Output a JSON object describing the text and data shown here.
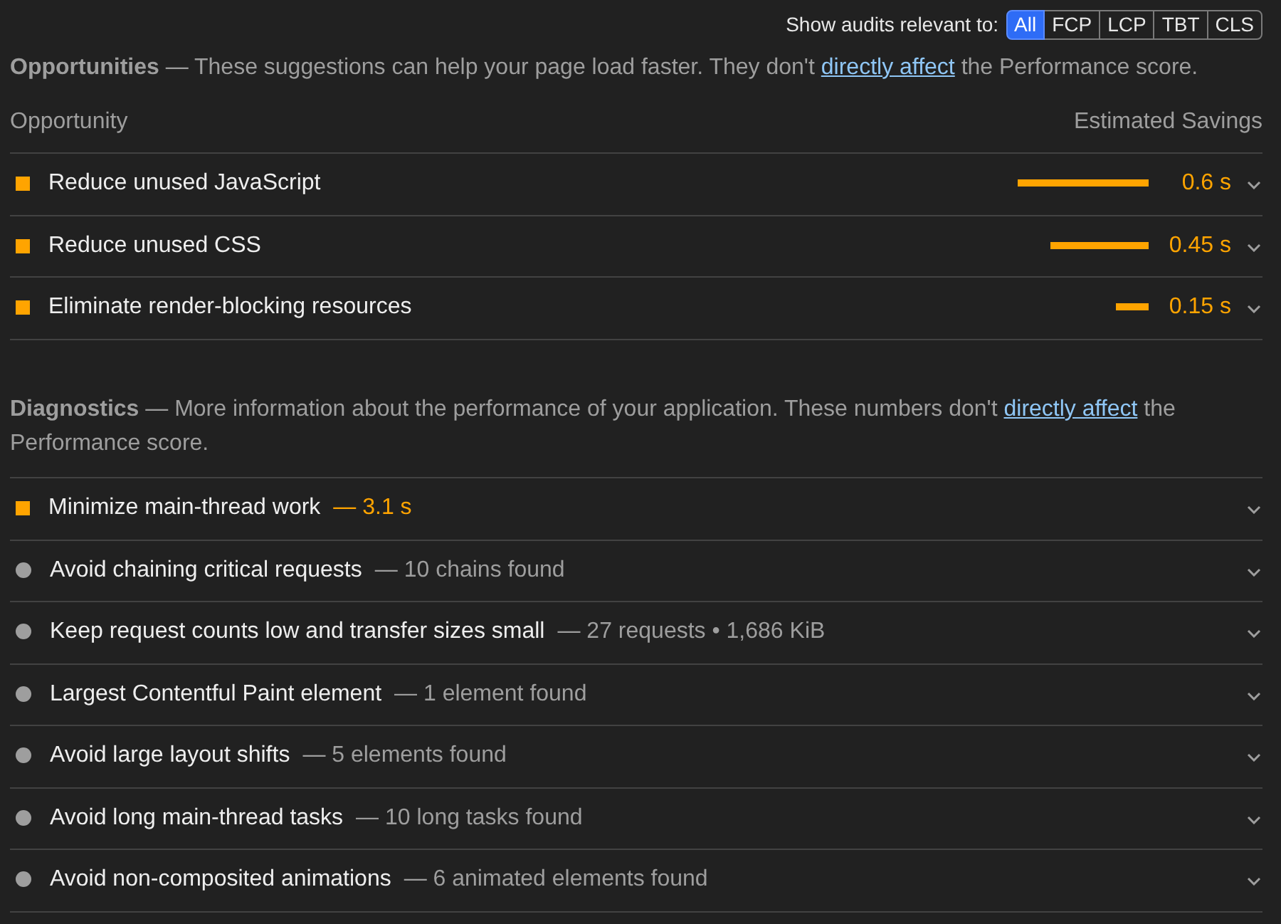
{
  "filter": {
    "label": "Show audits relevant to:",
    "options": [
      {
        "label": "All",
        "selected": true
      },
      {
        "label": "FCP",
        "selected": false
      },
      {
        "label": "LCP",
        "selected": false
      },
      {
        "label": "TBT",
        "selected": false
      },
      {
        "label": "CLS",
        "selected": false
      }
    ]
  },
  "opportunities": {
    "intro": {
      "text": "**Opportunities** — These suggestions can help your page load faster. They don't",
      "link": "directly affect",
      "text_after": "the Performance score."
    },
    "columns": [
      "Opportunity",
      "Estimated Savings"
    ],
    "rows": [
      {
        "kind": "average",
        "title": "Reduce unused JavaScript",
        "savings": "0.6 s"
      },
      {
        "kind": "average",
        "title": "Reduce unused CSS",
        "savings": "0.45 s"
      },
      {
        "kind": "average",
        "title": "Eliminate render-blocking resources",
        "savings": "0.15 s"
      }
    ]
  },
  "diagnostics": {
    "intro": {
      "text": "**Diagnostics** — More information about the performance of your application. These numbers don't",
      "link": "directly affect",
      "text_after": "the Performance score."
    },
    "rows": [
      {
        "kind": "average",
        "title": "Minimize main-thread work",
        "detail": "— 3.1 s"
      },
      {
        "kind": "informative",
        "title": "Avoid chaining critical requests",
        "detail": "— 10 chains found"
      },
      {
        "kind": "informative",
        "title": "Keep request counts low and transfer sizes small",
        "detail": "— 27 requests • 1,686 KiB"
      },
      {
        "kind": "informative",
        "title": "Largest Contentful Paint element",
        "detail": "— 1 element found"
      },
      {
        "kind": "informative",
        "title": "Avoid large layout shifts",
        "detail": "— 5 elements found"
      },
      {
        "kind": "informative",
        "title": "Avoid long main-thread tasks",
        "detail": "— 10 long tasks found"
      },
      {
        "kind": "informative",
        "title": "Avoid non-composited animations",
        "detail": "— 6 animated elements found"
      }
    ]
  }
}
